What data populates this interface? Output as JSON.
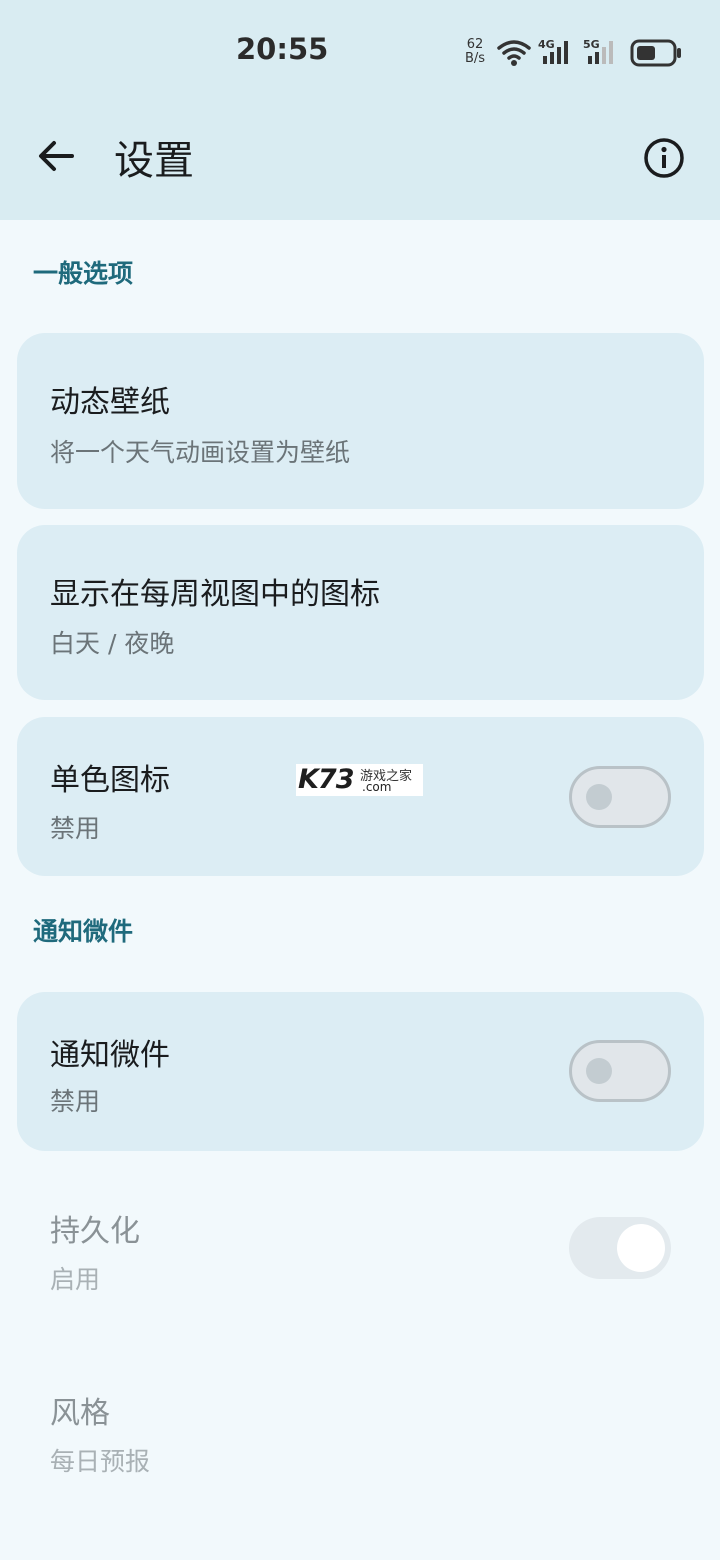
{
  "status_bar": {
    "time": "20:55",
    "net_speed_value": "62",
    "net_speed_unit": "B/s",
    "signal_1_label": "4G",
    "signal_2_label": "5G",
    "icons": [
      "wifi-icon",
      "signal-4g-icon",
      "signal-5g-icon",
      "battery-icon"
    ]
  },
  "header": {
    "title": "设置",
    "back_icon": "arrow-left-icon",
    "info_icon": "info-icon"
  },
  "sections": {
    "general": {
      "title": "一般选项"
    },
    "notification": {
      "title": "通知微件"
    }
  },
  "items": {
    "live_wallpaper": {
      "title": "动态壁纸",
      "subtitle": "将一个天气动画设置为壁纸"
    },
    "weekly_icons": {
      "title": "显示在每周视图中的图标",
      "subtitle": "白天 / 夜晚"
    },
    "mono_icons": {
      "title": "单色图标",
      "subtitle": "禁用",
      "toggle_on": false
    },
    "notification_widget": {
      "title": "通知微件",
      "subtitle": "禁用",
      "toggle_on": false
    },
    "persistent": {
      "title": "持久化",
      "subtitle": "启用",
      "toggle_on": true,
      "enabled": false
    },
    "style": {
      "title": "风格",
      "subtitle": "每日预报",
      "enabled": false
    }
  },
  "watermark": {
    "brand": "K73",
    "name": "游戏之家",
    "domain": ".com"
  },
  "colors": {
    "header_bg": "#d9ecf2",
    "page_bg": "#f2f9fc",
    "card_bg": "#dcedf4",
    "section_title": "#1f6a7c"
  }
}
